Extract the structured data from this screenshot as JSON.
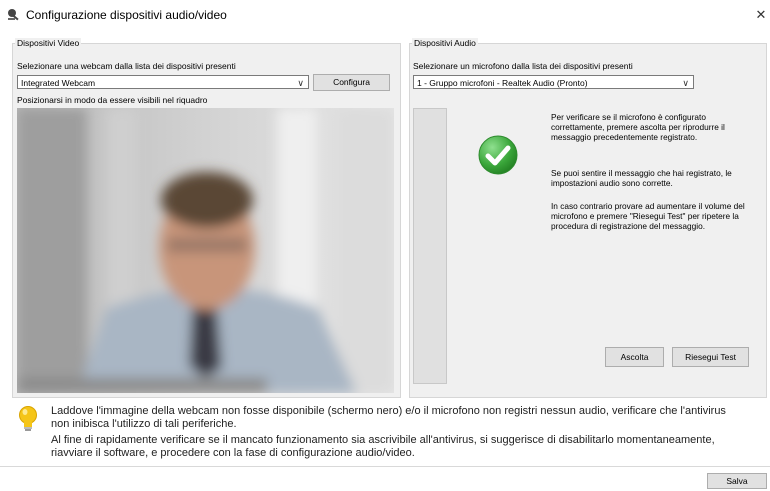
{
  "window": {
    "title": "Configurazione dispositivi audio/video"
  },
  "video": {
    "group_label": "Dispositivi Video",
    "select_label": "Selezionare una webcam dalla lista dei dispositivi presenti",
    "selected_webcam": "Integrated Webcam",
    "configure_button": "Configura",
    "position_hint": "Posizionarsi in modo da essere visibili nel riquadro"
  },
  "audio": {
    "group_label": "Dispositivi Audio",
    "select_label": "Selezionare un microfono dalla lista dei dispositivi presenti",
    "selected_microphone": "1 - Gruppo microfoni - Realtek Audio (Pronto)",
    "instructions": [
      "Per verificare se il microfono è configurato correttamente, premere ascolta per riprodurre il messaggio precedentemente registrato.",
      "Se puoi sentire il messaggio che hai registrato, le impostazioni audio sono corrette.",
      "In caso contrario provare ad aumentare il volume del microfono e premere \"Riesegui Test\" per ripetere la procedura di registrazione del messaggio."
    ],
    "listen_button": "Ascolta",
    "retest_button": "Riesegui Test"
  },
  "info": {
    "line1": "Laddove l'immagine della webcam non fosse disponibile (schermo nero) e/o il microfono non registri nessun audio, verificare che l'antivirus",
    "line2": "non inibisca l'utilizzo di tali periferiche.",
    "line3": "Al fine di rapidamente verificare se il mancato funzionamento sia ascrivibile all'antivirus, si suggerisce di disabilitarlo momentaneamente,",
    "line4": "riavviare il software, e procedere con la fase di configurazione audio/video."
  },
  "footer": {
    "save_button": "Salva"
  },
  "colors": {
    "accent_green": "#3aa63a",
    "window_bg": "#f0f0f0",
    "hint_yellow": "#f5c518"
  }
}
